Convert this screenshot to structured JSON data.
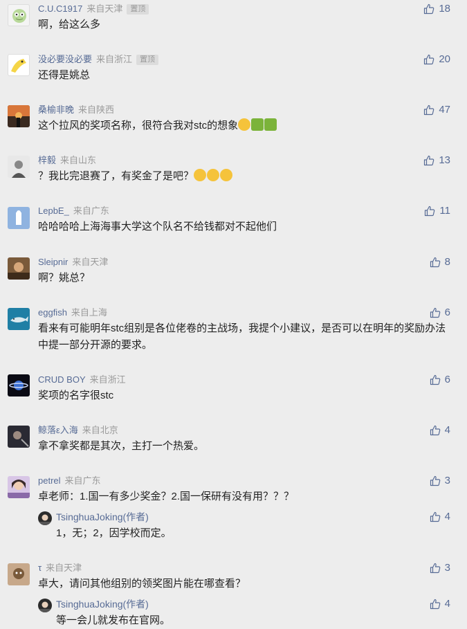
{
  "icons": {
    "like": "thumbs-up-icon"
  },
  "colors": {
    "nickname": "#576b95",
    "location": "#9a9a9a",
    "background": "#ededed"
  },
  "comments": [
    {
      "nickname": "C.U.C1917",
      "location": "来自天津",
      "pinned": "置顶",
      "text": "啊，给这么多",
      "likes": "18"
    },
    {
      "nickname": "没必要没必要",
      "location": "来自浙江",
      "pinned": "置顶",
      "text": "还得是姚总",
      "likes": "20"
    },
    {
      "nickname": "桑榆非晚",
      "location": "来自陕西",
      "text": "这个拉风的奖项名称，很符合我对stc的想象",
      "emojis": [
        "laugh-emoji",
        "thumbs-up-emoji",
        "thumbs-up-emoji"
      ],
      "likes": "47"
    },
    {
      "nickname": "梓毅",
      "location": "来自山东",
      "text": "？我比完退赛了，有奖金了是吧？",
      "emojis": [
        "crying-emoji",
        "crying-emoji",
        "crying-emoji"
      ],
      "likes": "13"
    },
    {
      "nickname": "LepbE_",
      "location": "来自广东",
      "text": "哈哈哈哈上海海事大学这个队名不给钱都对不起他们",
      "likes": "11"
    },
    {
      "nickname": "Sleipnir",
      "location": "来自天津",
      "text": "啊？姚总？",
      "likes": "8"
    },
    {
      "nickname": "eggfish",
      "location": "来自上海",
      "text": "看来有可能明年stc组别是各位佬卷的主战场，我提个小建议，是否可以在明年的奖励办法中提一部分开源的要求。",
      "likes": "6"
    },
    {
      "nickname": "CRUD BOY",
      "location": "来自浙江",
      "text": "奖项的名字很stc",
      "likes": "6"
    },
    {
      "nickname": "鲸落ε入海",
      "location": "来自北京",
      "text": "拿不拿奖都是其次，主打一个热爱。",
      "likes": "4"
    },
    {
      "nickname": "petrel",
      "location": "来自广东",
      "text": "卓老师：1.国一有多少奖金？2.国一保研有没有用？？？",
      "likes": "3",
      "reply": {
        "nickname": "TsinghuaJoking(作者)",
        "text": "1，无；2，因学校而定。",
        "likes": "4"
      }
    },
    {
      "nickname": "τ",
      "location": "来自天津",
      "text": "卓大，请问其他组别的领奖图片能在哪查看？",
      "likes": "3",
      "reply": {
        "nickname": "TsinghuaJoking(作者)",
        "text": "等一会儿就发布在官网。",
        "likes": "4"
      }
    }
  ]
}
